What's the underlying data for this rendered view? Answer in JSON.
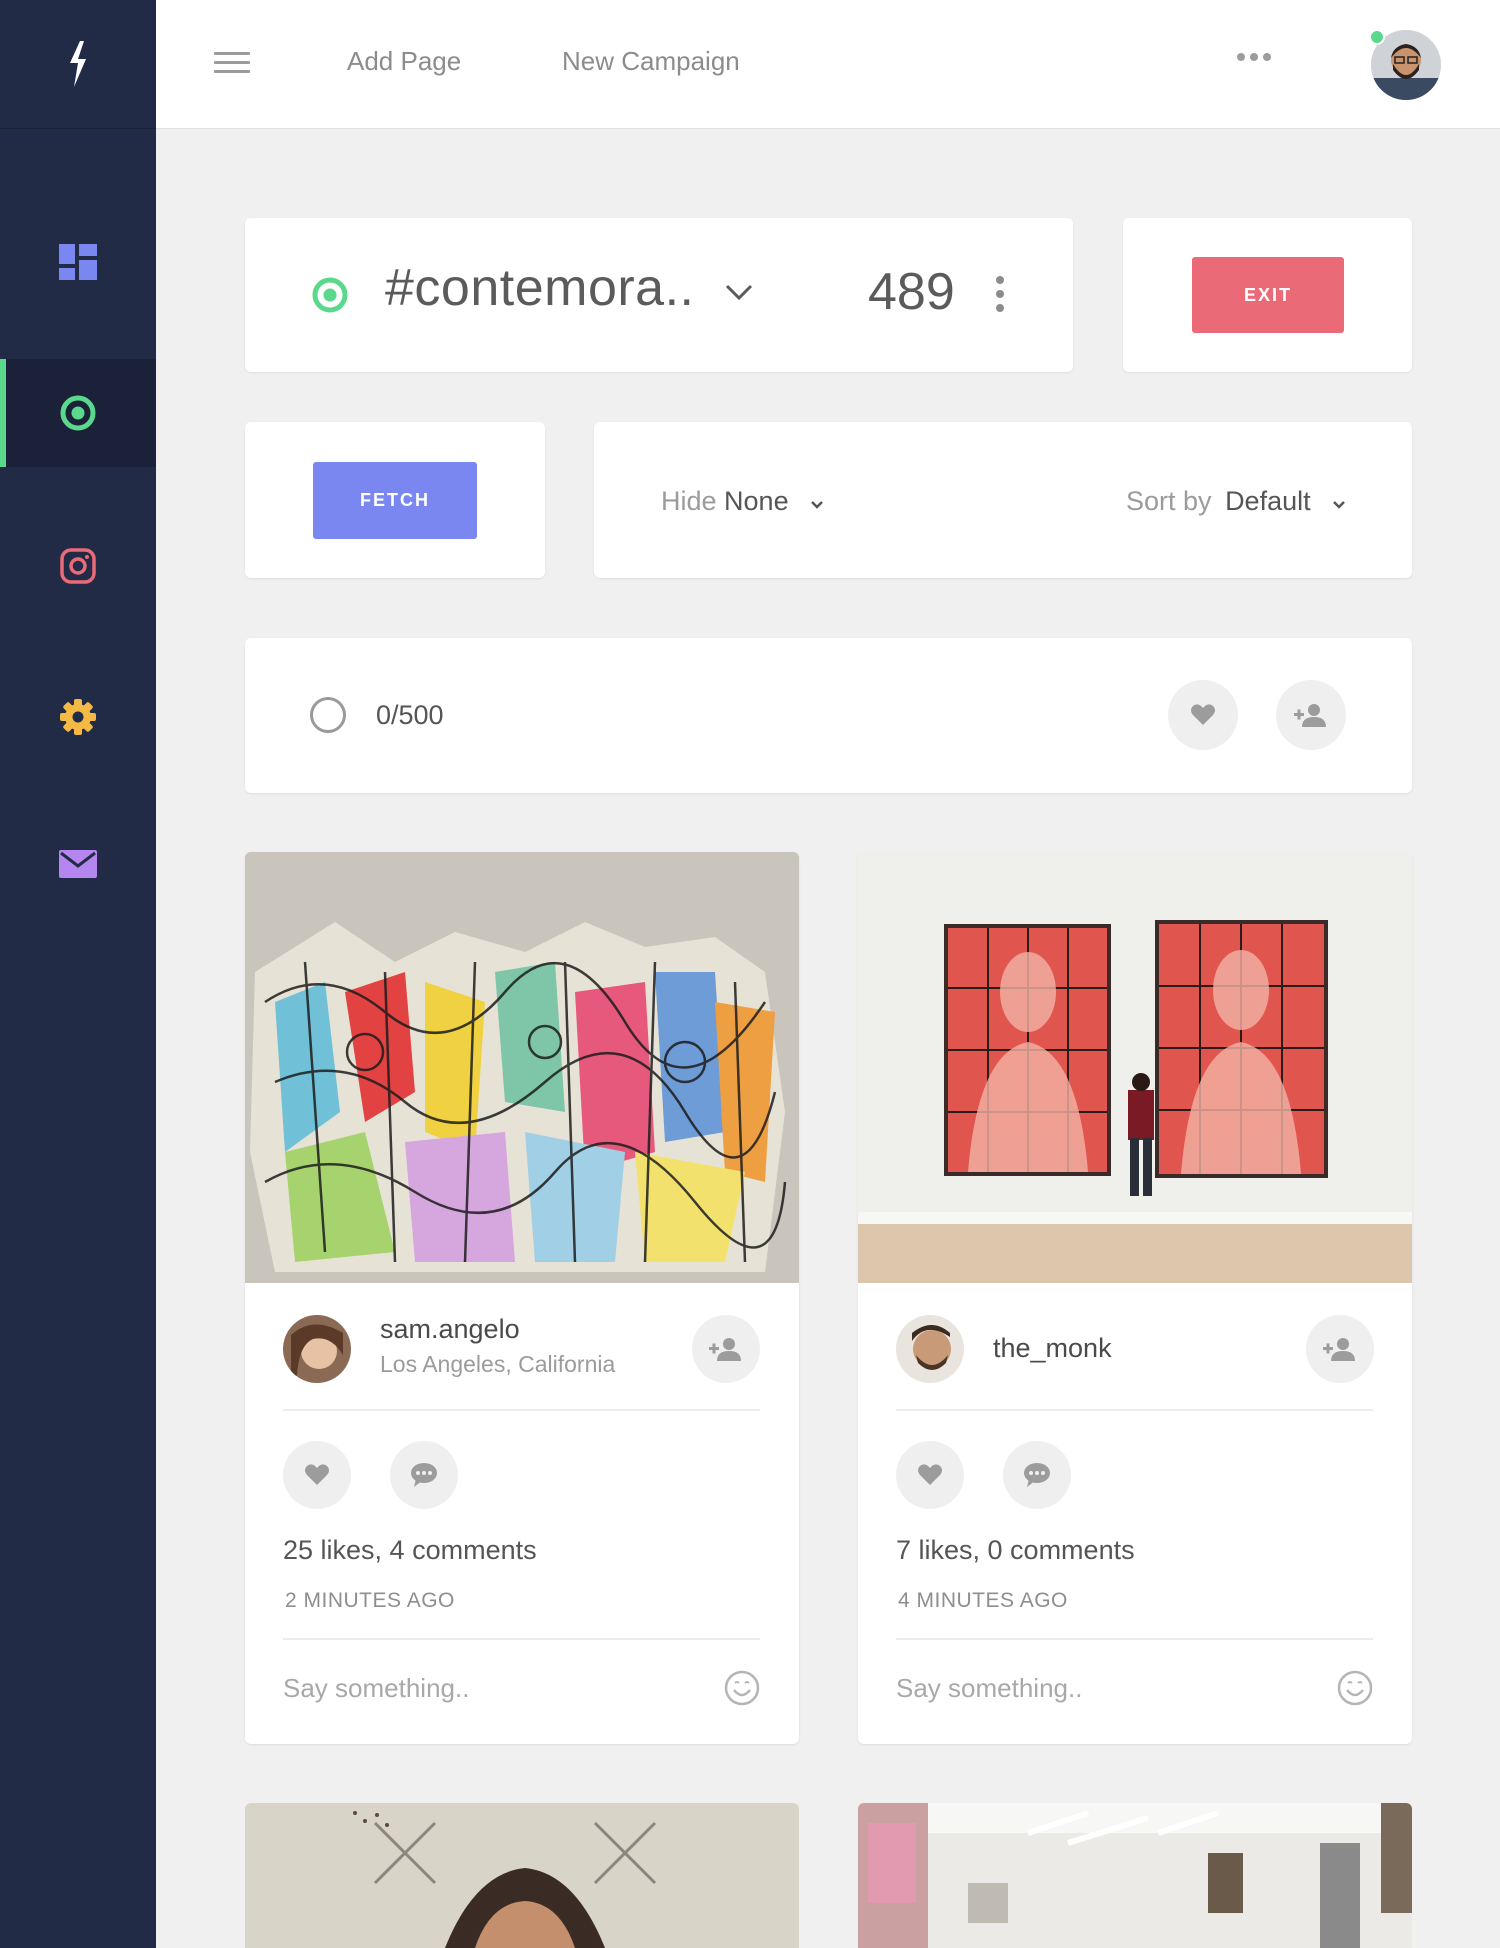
{
  "colors": {
    "sidebar_bg": "#222b45",
    "active_accent": "#5ad88c",
    "exit_button": "#ea6a78",
    "fetch_button": "#7b87f0"
  },
  "sidebar": {
    "logo_icon": "lightning-bolt-icon",
    "items": [
      {
        "icon": "dashboard-icon",
        "active": false
      },
      {
        "icon": "target-icon",
        "active": true
      },
      {
        "icon": "instagram-icon",
        "active": false
      },
      {
        "icon": "gear-icon",
        "active": false
      },
      {
        "icon": "mail-icon",
        "active": false
      }
    ]
  },
  "topbar": {
    "menu_icon": "hamburger-icon",
    "links": [
      "Add Page",
      "New Campaign"
    ],
    "more_icon": "more-horizontal-icon",
    "avatar_status": "online"
  },
  "campaign": {
    "hashtag": "#contemora..",
    "count": "489",
    "exit_label": "EXIT"
  },
  "controls": {
    "fetch_label": "FETCH",
    "hide_label": "Hide",
    "hide_value": "None",
    "sort_label": "Sort by",
    "sort_value": "Default"
  },
  "progress": {
    "text": "0/500"
  },
  "posts": [
    {
      "username": "sam.angelo",
      "location": "Los Angeles, California",
      "stats": "25 likes, 4 comments",
      "time": "2 MINUTES AGO",
      "comment_placeholder": "Say something.."
    },
    {
      "username": "the_monk",
      "location": "",
      "stats": "7 likes, 0 comments",
      "time": "4 MINUTES AGO",
      "comment_placeholder": "Say something.."
    }
  ]
}
